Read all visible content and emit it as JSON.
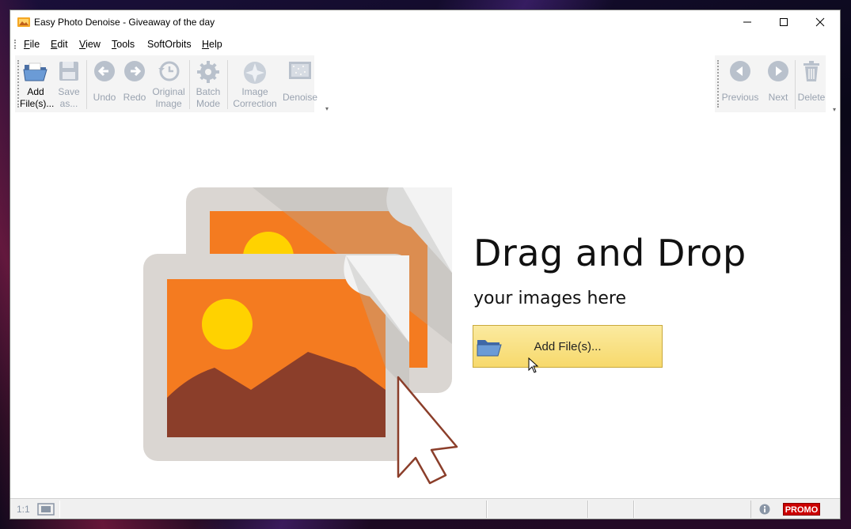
{
  "window": {
    "title": "Easy Photo Denoise - Giveaway of the day"
  },
  "menu": [
    {
      "label": "File",
      "mnemonic": "F"
    },
    {
      "label": "Edit",
      "mnemonic": "E"
    },
    {
      "label": "View",
      "mnemonic": "V"
    },
    {
      "label": "Tools",
      "mnemonic": "T"
    },
    {
      "label": "SoftOrbits",
      "mnemonic": ""
    },
    {
      "label": "Help",
      "mnemonic": "H"
    }
  ],
  "toolbar": {
    "add_files": {
      "line1": "Add",
      "line2": "File(s)..."
    },
    "save_as": {
      "line1": "Save",
      "line2": "as..."
    },
    "undo": "Undo",
    "redo": "Redo",
    "original_image": {
      "line1": "Original",
      "line2": "Image"
    },
    "batch_mode": {
      "line1": "Batch",
      "line2": "Mode"
    },
    "image_correction": {
      "line1": "Image",
      "line2": "Correction"
    },
    "denoise": "Denoise",
    "previous": "Previous",
    "next": "Next",
    "delete": "Delete"
  },
  "main": {
    "headline": "Drag and Drop",
    "subline": "your images here",
    "add_button": "Add File(s)..."
  },
  "status": {
    "zoom_ratio": "1:1",
    "promo": "PROMO"
  },
  "colors": {
    "accent_button": "#f7d96c",
    "illus_orange": "#f47b20",
    "illus_sun": "#ffd200",
    "illus_mountain": "#8b3e2a",
    "promo_red": "#cc0000"
  }
}
